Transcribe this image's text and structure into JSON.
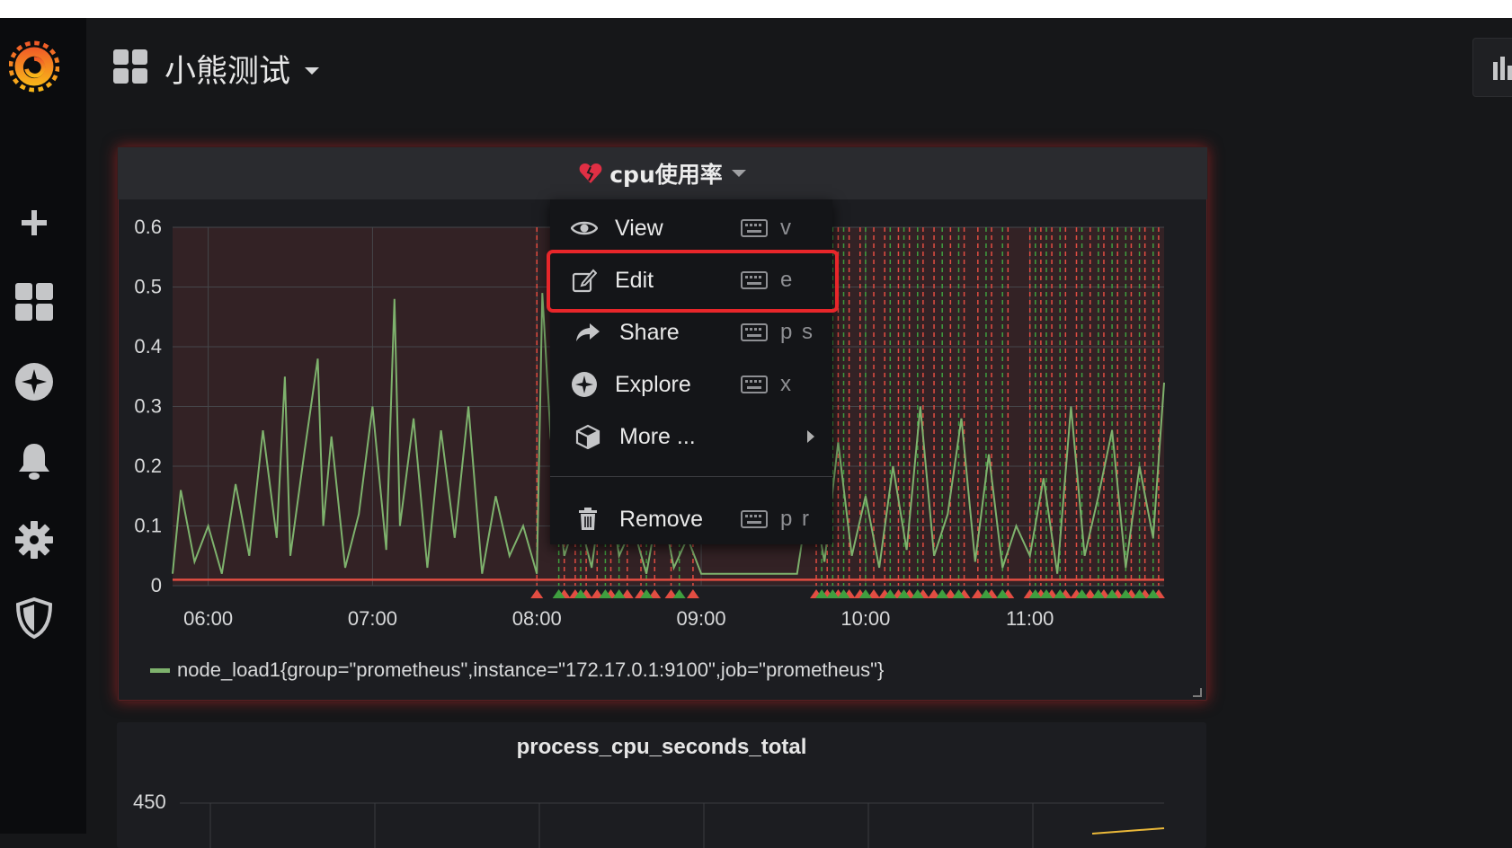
{
  "dashboard": {
    "title": "小熊测试"
  },
  "panel1": {
    "title": "cpu使用率",
    "legend": "node_load1{group=\"prometheus\",instance=\"172.17.0.1:9100\",job=\"prometheus\"}"
  },
  "menu": {
    "items": [
      {
        "label": "View",
        "shortcut": "v",
        "icon": "eye-icon"
      },
      {
        "label": "Edit",
        "shortcut": "e",
        "icon": "edit-icon"
      },
      {
        "label": "Share",
        "shortcut": "p s",
        "icon": "share-icon"
      },
      {
        "label": "Explore",
        "shortcut": "x",
        "icon": "compass-icon"
      },
      {
        "label": "More ...",
        "shortcut": "",
        "icon": "cube-icon"
      },
      {
        "label": "Remove",
        "shortcut": "p r",
        "icon": "trash-icon"
      }
    ]
  },
  "panel2": {
    "title": "process_cpu_seconds_total",
    "ytick": "450"
  },
  "colors": {
    "series": "#7eb26d",
    "alert_line": "#e24d42",
    "ok_line": "#3f9f3f",
    "highlight": "#e8262a"
  },
  "chart_data": {
    "type": "line",
    "yticks": [
      "0",
      "0.1",
      "0.2",
      "0.3",
      "0.4",
      "0.5",
      "0.6"
    ],
    "xticks": [
      "06:00",
      "07:00",
      "08:00",
      "09:00",
      "10:00",
      "11:00"
    ],
    "ylim": [
      0,
      0.6
    ],
    "xlim": [
      "05:47",
      "11:49"
    ],
    "threshold": 0.01,
    "series": [
      {
        "name": "node_load1{group=\"prometheus\",instance=\"172.17.0.1:9100\",job=\"prometheus\"}",
        "x": [
          "05:47",
          "05:50",
          "05:55",
          "06:00",
          "06:05",
          "06:10",
          "06:15",
          "06:20",
          "06:25",
          "06:28",
          "06:30",
          "06:35",
          "06:40",
          "06:42",
          "06:45",
          "06:50",
          "06:55",
          "07:00",
          "07:05",
          "07:08",
          "07:10",
          "07:15",
          "07:20",
          "07:25",
          "07:30",
          "07:35",
          "07:40",
          "07:45",
          "07:50",
          "07:55",
          "08:00",
          "08:02",
          "08:05",
          "08:10",
          "08:15",
          "08:20",
          "08:25",
          "08:30",
          "08:35",
          "08:40",
          "08:45",
          "08:50",
          "08:55",
          "09:00",
          "09:35",
          "09:40",
          "09:45",
          "09:50",
          "09:55",
          "10:00",
          "10:05",
          "10:10",
          "10:15",
          "10:20",
          "10:25",
          "10:30",
          "10:35",
          "10:40",
          "10:45",
          "10:50",
          "10:55",
          "11:00",
          "11:05",
          "11:10",
          "11:15",
          "11:20",
          "11:25",
          "11:30",
          "11:35",
          "11:40",
          "11:45",
          "11:49"
        ],
        "values": [
          0.02,
          0.16,
          0.04,
          0.1,
          0.02,
          0.17,
          0.05,
          0.26,
          0.08,
          0.35,
          0.05,
          0.22,
          0.38,
          0.1,
          0.25,
          0.03,
          0.12,
          0.3,
          0.06,
          0.48,
          0.1,
          0.28,
          0.03,
          0.26,
          0.08,
          0.3,
          0.02,
          0.15,
          0.05,
          0.1,
          0.02,
          0.49,
          0.25,
          0.05,
          0.12,
          0.03,
          0.2,
          0.05,
          0.1,
          0.02,
          0.15,
          0.03,
          0.08,
          0.02,
          0.02,
          0.17,
          0.04,
          0.24,
          0.05,
          0.15,
          0.03,
          0.2,
          0.06,
          0.3,
          0.05,
          0.12,
          0.28,
          0.04,
          0.22,
          0.03,
          0.1,
          0.05,
          0.18,
          0.02,
          0.3,
          0.05,
          0.15,
          0.26,
          0.03,
          0.2,
          0.08,
          0.34
        ]
      }
    ],
    "annotations": {
      "alert_times": [
        "08:00",
        "08:10",
        "08:14",
        "08:18",
        "08:22",
        "08:27",
        "08:33",
        "08:38",
        "08:43",
        "08:49",
        "08:57",
        "09:42",
        "09:46",
        "09:50",
        "09:54",
        "09:58",
        "10:03",
        "10:07",
        "10:12",
        "10:16",
        "10:21",
        "10:25",
        "10:31",
        "10:36",
        "10:41",
        "10:46",
        "10:52",
        "11:00",
        "11:04",
        "11:08",
        "11:13",
        "11:17",
        "11:22",
        "11:27",
        "11:32",
        "11:37",
        "11:42",
        "11:47"
      ],
      "ok_times": [
        "08:08",
        "08:16",
        "08:25",
        "08:30",
        "08:40",
        "08:52",
        "09:44",
        "09:48",
        "09:52",
        "10:00",
        "10:09",
        "10:14",
        "10:19",
        "10:28",
        "10:34",
        "10:44",
        "10:50",
        "11:02",
        "11:06",
        "11:11",
        "11:19",
        "11:25",
        "11:30",
        "11:35",
        "11:40",
        "11:45"
      ]
    }
  },
  "chart2_data": {
    "type": "line",
    "yticks": [
      "450"
    ]
  }
}
